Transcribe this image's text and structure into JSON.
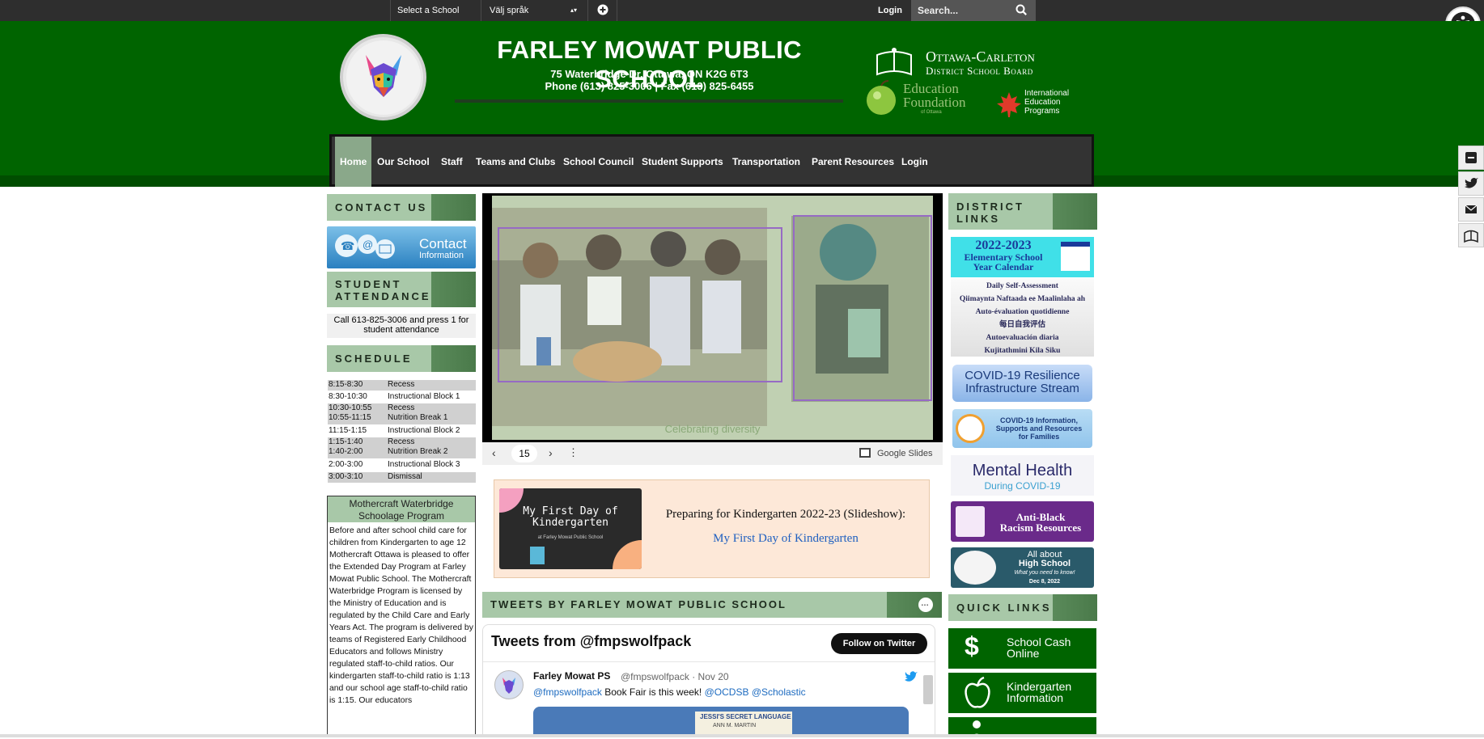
{
  "topbar": {
    "select_school": "Select a School",
    "language": "Välj språk",
    "login": "Login",
    "search_placeholder": "Search..."
  },
  "header": {
    "title": "FARLEY MOWAT PUBLIC SCHOOL",
    "address": "75 Waterbridge Dr, Ottawa, ON K2G 6T3",
    "phone": "Phone (613) 825-3006 | Fax (613) 825-6455",
    "board_line1": "Ottawa-Carleton",
    "board_line2": "District School Board",
    "foundation1": "Education",
    "foundation2": "Foundation",
    "foundation3": "of Ottawa",
    "iep1": "International",
    "iep2": "Education",
    "iep3": "Programs"
  },
  "nav": {
    "items": [
      "Home",
      "Our School",
      "Staff",
      "Teams and Clubs",
      "School Council",
      "Student Supports",
      "Transportation",
      "Parent Resources",
      "Login"
    ]
  },
  "left": {
    "contact_heading": "CONTACT US",
    "contact_tile_1": "Contact",
    "contact_tile_2": "Information",
    "attendance_heading_1": "STUDENT",
    "attendance_heading_2": "ATTENDANCE",
    "attendance_text": "Call 613-825-3006 and press 1 for student attendance",
    "schedule_heading": "SCHEDULE",
    "schedule": [
      {
        "time": "8:15-8:30",
        "label": "Recess"
      },
      {
        "time": "8:30-10:30",
        "label": "Instructional Block 1"
      },
      {
        "time": "10:30-10:55",
        "label": "Recess"
      },
      {
        "time": "10:55-11:15",
        "label": "Nutrition Break 1"
      },
      {
        "time": "11:15-1:15",
        "label": "Instructional Block 2"
      },
      {
        "time": "1:15-1:40",
        "label": "Recess"
      },
      {
        "time": "1:40-2:00",
        "label": "Nutrition Break 2"
      },
      {
        "time": "2:00-3:00",
        "label": "Instructional Block 3"
      },
      {
        "time": "3:00-3:10",
        "label": "Dismissal"
      }
    ],
    "mothercraft_title_1": "Mothercraft Waterbridge",
    "mothercraft_title_2": "Schoolage Program",
    "mothercraft_intro": "Before and after school child care for children from Kindergarten to age 12",
    "mothercraft_body": "Mothercraft Ottawa is pleased to offer the Extended Day Program at Farley Mowat Public School. The Mothercraft Waterbridge Program is licensed by the Ministry of Education and is regulated by the Child Care and Early Years Act. The program is delivered by teams of Registered Early Childhood Educators and follows Ministry regulated staff-to-child ratios. Our kindergarten staff-to-child ratio is 1:13 and our school age staff-to-child ratio is 1:15. Our educators"
  },
  "center": {
    "slide_caption": "Celebrating diversity",
    "slide_number": "15",
    "google_slides": "Google Slides",
    "kinder_card_title_1": "My First Day of",
    "kinder_card_title_2": "Kindergarten",
    "kinder_card_sub": "at Farley Mowat Public School",
    "kinder_heading": "Preparing for Kindergarten 2022-23 (Slideshow):",
    "kinder_link": "My First Day of Kindergarten",
    "tweets_heading": "TWEETS BY FARLEY MOWAT PUBLIC SCHOOL",
    "tweets_from": "Tweets from @fmpswolfpack",
    "follow": "Follow on Twitter",
    "tweet_name": "Farley Mowat PS",
    "tweet_handle": "@fmpswolfpack · Nov 20",
    "tweet_mention": "@fmpswolfpack",
    "tweet_text": "Book Fair is this week!",
    "tweet_tag1": "@OCDSB",
    "tweet_tag2": "@Scholastic",
    "book_title": "JESSI'S SECRET LANGUAGE",
    "book_author": "ANN M. MARTIN"
  },
  "right": {
    "district_heading_1": "DISTRICT",
    "district_heading_2": "LINKS",
    "calendar_1": "2022-2023",
    "calendar_2": "Elementary School",
    "calendar_3": "Year Calendar",
    "self_assess": [
      "Daily Self-Assessment",
      "Qiimaynta Naftaada ee Maalinlaha ah",
      "Auto-évaluation quotidienne",
      "每日自我评估",
      "Autoevaluación diaria",
      "Kujitathmini Kila Siku"
    ],
    "covid_resilience_1": "COVID-19 Resilience",
    "covid_resilience_2": "Infrastructure Stream",
    "covid_info_1": "COVID-19 Information,",
    "covid_info_2": "Supports and Resources",
    "covid_info_3": "for Families",
    "mental_1": "Mental Health",
    "mental_2": "During COVID-19",
    "antiblack_1": "Anti-Black",
    "antiblack_2": "Racism Resources",
    "hs_1": "All about",
    "hs_2": "High School",
    "hs_3": "What you need to know!",
    "hs_4": "Dec 8, 2022",
    "quick_heading": "QUICK LINKS",
    "quick": [
      {
        "l1": "School Cash",
        "l2": "Online"
      },
      {
        "l1": "Kindergarten",
        "l2": "Information"
      }
    ]
  },
  "colors": {
    "brand_green": "#006400",
    "dark_bar": "#2e2e2e",
    "heading_green": "#a8c8a8"
  }
}
